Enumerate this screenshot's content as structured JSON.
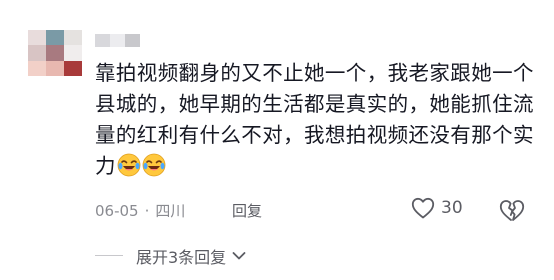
{
  "comment": {
    "text": "靠拍视频翻身的又不止她一个，我老家跟她一个县城的，她早期的生活都是真实的，她能抓住流量的红利有什么不对，我想拍视频还没有那个实力",
    "emoji_count": 2,
    "emoji_icon": "crying-laughing-emoji",
    "date": "06-05",
    "separator": "·",
    "location": "四川",
    "reply_label": "回复",
    "like_count": "30",
    "like_icon": "heart-outline-icon",
    "dislike_icon": "broken-heart-icon",
    "expand_label": "展开3条回复",
    "expand_icon": "chevron-down-icon"
  },
  "avatar_colors": [
    "#e8dcdc",
    "#7a9aa6",
    "#e5e2e0",
    "#d8c4c4",
    "#a87a80",
    "#f0eded",
    "#f2d0c8",
    "#e8b8b0",
    "#a83a3a"
  ],
  "username_colors": [
    "#d8d8dc",
    "#ececef",
    "#c8c8cc"
  ],
  "colors": {
    "text": "#161823",
    "meta": "#8a8b91",
    "action": "#5b5c63"
  }
}
